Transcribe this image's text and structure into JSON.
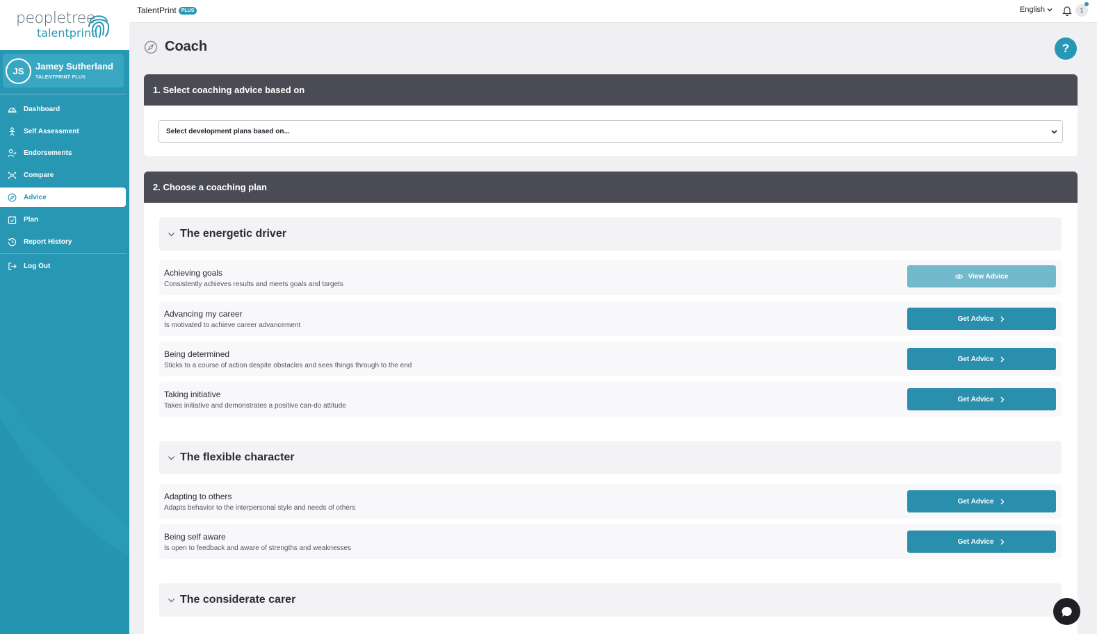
{
  "brand": {
    "logo_name": "peopletree",
    "logo_sub": "talentprint",
    "product": "TalentPrint",
    "product_badge": "PLUS",
    "colors": {
      "accent": "#2897b4",
      "dark_header": "#4b4b55",
      "button": "#2a8fac",
      "button_disabled": "#72b9cb"
    }
  },
  "user": {
    "initials": "JS",
    "name": "Jamey Sutherland",
    "plan": "TALENTPRINT PLUS"
  },
  "sidebar": {
    "items": [
      {
        "label": "Dashboard",
        "icon": "gauge-icon",
        "active": false
      },
      {
        "label": "Self Assessment",
        "icon": "person-assessment-icon",
        "active": false
      },
      {
        "label": "Endorsements",
        "icon": "user-check-icon",
        "active": false
      },
      {
        "label": "Compare",
        "icon": "network-icon",
        "active": false
      },
      {
        "label": "Advice",
        "icon": "compass-icon",
        "active": true
      },
      {
        "label": "Plan",
        "icon": "calendar-check-icon",
        "active": false
      },
      {
        "label": "Report History",
        "icon": "history-icon",
        "active": false
      }
    ],
    "logout": {
      "label": "Log Out",
      "icon": "logout-icon"
    }
  },
  "topbar": {
    "language": "English",
    "notification_count": "1"
  },
  "page": {
    "title": "Coach",
    "title_icon": "compass-icon",
    "help_label": "?"
  },
  "section1": {
    "title": "1. Select coaching advice based on",
    "select_value": "Select development plans based on..."
  },
  "section2": {
    "title": "2. Choose a coaching plan",
    "groups": [
      {
        "title": "The energetic driver",
        "items": [
          {
            "title": "Achieving goals",
            "desc": "Consistently achieves results and meets goals and targets",
            "button": "View Advice"
          },
          {
            "title": "Advancing my career",
            "desc": "Is motivated to achieve career advancement",
            "button": "Get Advice"
          },
          {
            "title": "Being determined",
            "desc": "Sticks to a course of action despite obstacles and sees things through to the end",
            "button": "Get Advice"
          },
          {
            "title": "Taking initiative",
            "desc": "Takes initiative and demonstrates a positive can-do attitude",
            "button": "Get Advice"
          }
        ]
      },
      {
        "title": "The flexible character",
        "items": [
          {
            "title": "Adapting to others",
            "desc": "Adapts behavior to the interpersonal style and needs of others",
            "button": "Get Advice"
          },
          {
            "title": "Being self aware",
            "desc": "Is open to feedback and aware of strengths and weaknesses",
            "button": "Get Advice"
          }
        ]
      },
      {
        "title": "The considerate carer",
        "items": []
      }
    ]
  }
}
